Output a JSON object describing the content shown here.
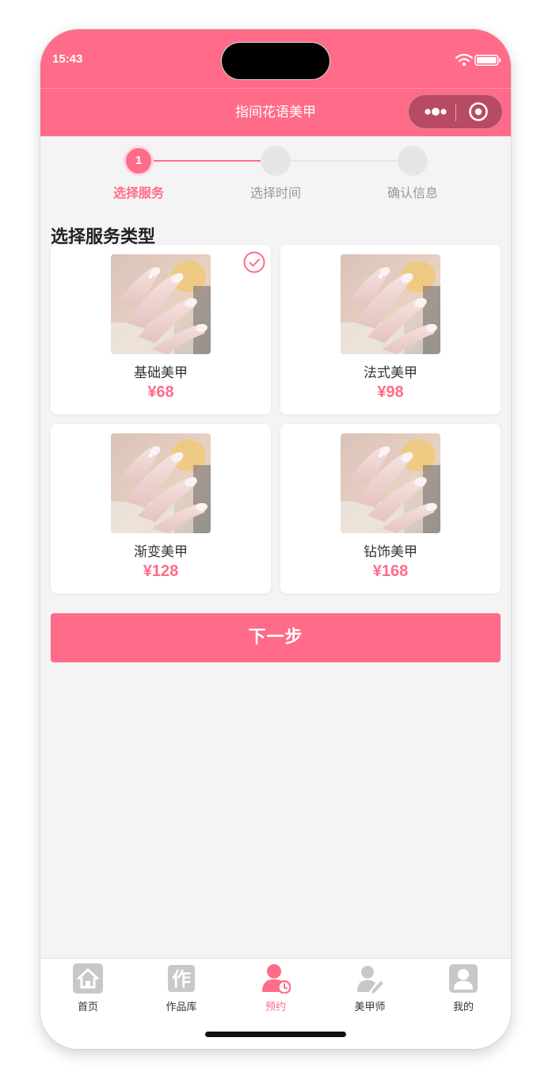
{
  "status_bar": {
    "time": "15:43",
    "icons": [
      "wifi-icon",
      "battery-icon"
    ]
  },
  "nav": {
    "title": "指间花语美甲",
    "capsule_icons": [
      "more-dots-icon",
      "close-target-icon"
    ]
  },
  "steps": [
    {
      "number": "1",
      "label": "选择服务",
      "active": true
    },
    {
      "number": "",
      "label": "选择时间",
      "active": false
    },
    {
      "number": "",
      "label": "确认信息",
      "active": false
    }
  ],
  "section_title": "选择服务类型",
  "services": [
    {
      "name": "基础美甲",
      "price": "¥68",
      "selected": true,
      "image": "nail-photo"
    },
    {
      "name": "法式美甲",
      "price": "¥98",
      "selected": false,
      "image": "nail-photo"
    },
    {
      "name": "渐变美甲",
      "price": "¥128",
      "selected": false,
      "image": "nail-photo"
    },
    {
      "name": "钻饰美甲",
      "price": "¥168",
      "selected": false,
      "image": "nail-photo"
    }
  ],
  "next_button": "下一步",
  "tabs": [
    {
      "label": "首页",
      "icon": "home-icon",
      "active": false
    },
    {
      "label": "作品库",
      "icon": "portfolio-icon",
      "active": false
    },
    {
      "label": "预约",
      "icon": "booking-icon",
      "active": true
    },
    {
      "label": "美甲师",
      "icon": "manicurist-icon",
      "active": false
    },
    {
      "label": "我的",
      "icon": "profile-icon",
      "active": false
    }
  ],
  "colors": {
    "primary": "#ff6b88",
    "background": "#f4f4f4",
    "inactive": "#e6e6e6",
    "tab_icon": "#c8c8c8"
  }
}
